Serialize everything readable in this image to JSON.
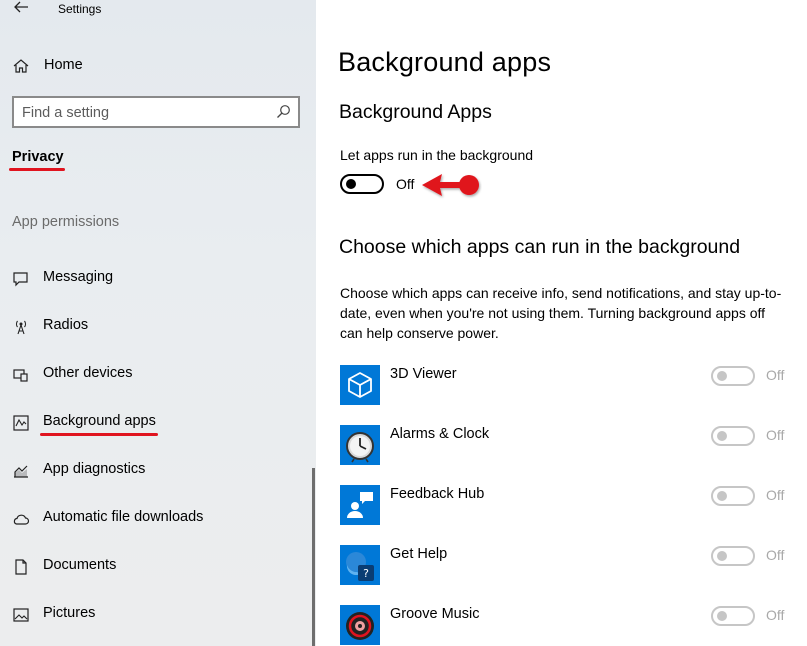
{
  "window": {
    "title": "Settings"
  },
  "sidebar": {
    "home_label": "Home",
    "search_placeholder": "Find a setting",
    "category": "Privacy",
    "section_heading": "App permissions",
    "items": [
      {
        "label": "Messaging",
        "icon": "messaging-icon"
      },
      {
        "label": "Radios",
        "icon": "radios-icon"
      },
      {
        "label": "Other devices",
        "icon": "other-devices-icon"
      },
      {
        "label": "Background apps",
        "icon": "background-apps-icon"
      },
      {
        "label": "App diagnostics",
        "icon": "app-diagnostics-icon"
      },
      {
        "label": "Automatic file downloads",
        "icon": "cloud-icon"
      },
      {
        "label": "Documents",
        "icon": "document-icon"
      },
      {
        "label": "Pictures",
        "icon": "pictures-icon"
      }
    ]
  },
  "main": {
    "page_title": "Background apps",
    "section_title": "Background Apps",
    "master_toggle": {
      "label": "Let apps run in the background",
      "state": "Off"
    },
    "apps_section_title": "Choose which apps can run in the background",
    "description": "Choose which apps can receive info, send notifications, and stay up-to-date, even when you're not using them. Turning background apps off can help conserve power.",
    "apps": [
      {
        "name": "3D Viewer",
        "state": "Off",
        "icon": "3d-viewer-icon"
      },
      {
        "name": "Alarms & Clock",
        "state": "Off",
        "icon": "alarms-clock-icon"
      },
      {
        "name": "Feedback Hub",
        "state": "Off",
        "icon": "feedback-hub-icon"
      },
      {
        "name": "Get Help",
        "state": "Off",
        "icon": "get-help-icon"
      },
      {
        "name": "Groove Music",
        "state": "Off",
        "icon": "groove-music-icon"
      }
    ]
  },
  "colors": {
    "accent": "#0078d7",
    "annotation": "#e0141f",
    "disabled": "#c6c6c6"
  }
}
